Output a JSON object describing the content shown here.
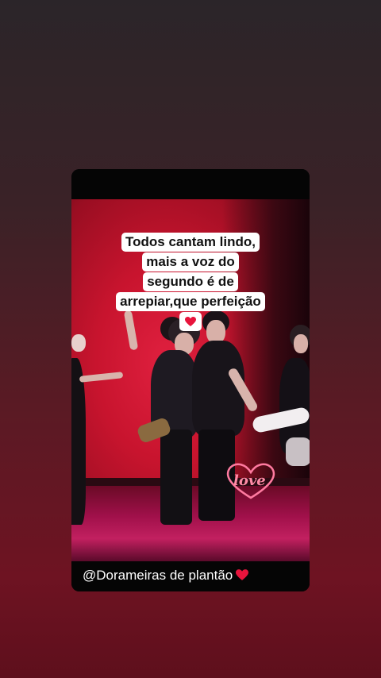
{
  "story": {
    "caption_lines": [
      "Todos cantam lindo,",
      "mais a voz do",
      "segundo é de",
      "arrepiar,que perfeição"
    ],
    "caption_emoji": "heart-emoji",
    "stage_sign_text": "love",
    "watermark_text": "@Dorameiras de plantão",
    "watermark_emoji": "heart-emoji"
  },
  "colors": {
    "background_top": "#2b2529",
    "background_bottom": "#6e1322",
    "stage_red": "#c8142e",
    "heart": "#e8143c",
    "caption_bg": "#ffffff"
  }
}
